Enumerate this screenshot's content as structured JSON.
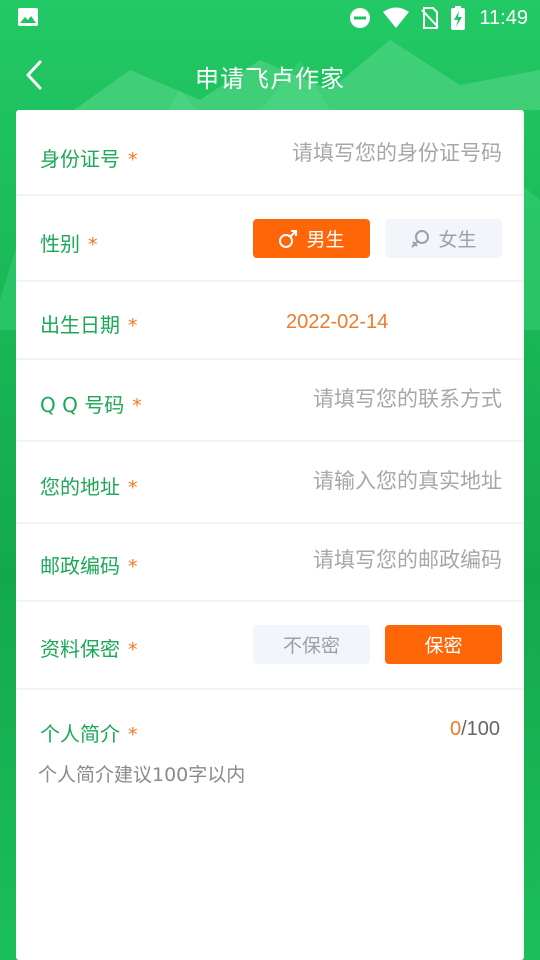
{
  "status_bar": {
    "time": "11:49",
    "icons": [
      "gallery-icon",
      "dnd-icon",
      "wifi-icon",
      "no-sim-icon",
      "battery-charging-icon"
    ]
  },
  "header": {
    "title": "申请飞卢作家",
    "back_icon": "chevron-left-icon"
  },
  "form": {
    "required_mark": "*",
    "id_number": {
      "label": "身份证号",
      "placeholder": "请填写您的身份证号码",
      "value": ""
    },
    "gender": {
      "label": "性别",
      "options": [
        {
          "label": "男生",
          "icon": "male-icon",
          "selected": true
        },
        {
          "label": "女生",
          "icon": "female-icon",
          "selected": false
        }
      ]
    },
    "birthdate": {
      "label": "出生日期",
      "value": "2022-02-14"
    },
    "qq": {
      "label": "Q Q 号码",
      "placeholder": "请填写您的联系方式",
      "value": ""
    },
    "address": {
      "label": "您的地址",
      "placeholder": "请输入您的真实地址",
      "value": ""
    },
    "postcode": {
      "label": "邮政编码",
      "placeholder": "请填写您的邮政编码",
      "value": ""
    },
    "privacy": {
      "label": "资料保密",
      "options": [
        {
          "label": "不保密",
          "selected": false
        },
        {
          "label": "保密",
          "selected": true
        }
      ]
    },
    "bio": {
      "label": "个人简介",
      "placeholder": "个人简介建议100字以内",
      "count": "0",
      "max": "/100"
    }
  },
  "colors": {
    "brand_green": "#1ba957",
    "accent_orange": "#fe6608",
    "required_orange": "#f07a27"
  }
}
